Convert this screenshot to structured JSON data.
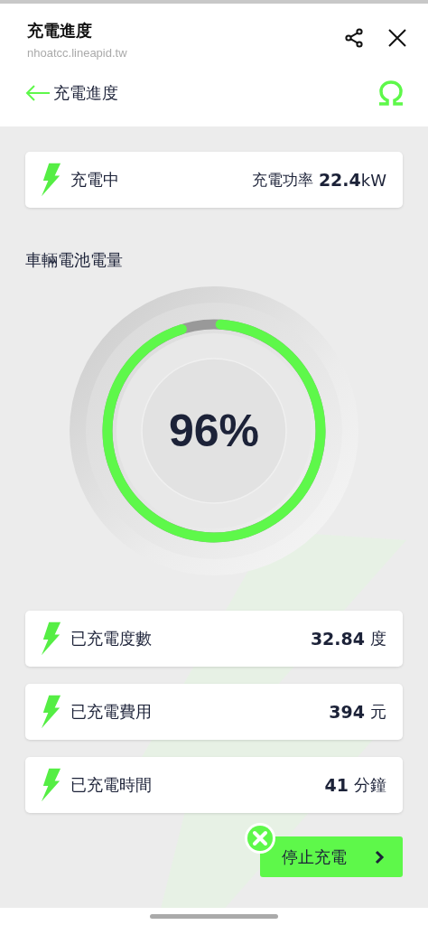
{
  "browser": {
    "title": "充電進度",
    "url": "nhoatcc.lineapid.tw"
  },
  "nav": {
    "title": "充電進度"
  },
  "status": {
    "label": "充電中",
    "power_label": "充電功率",
    "power_value": "22.4",
    "power_unit": "kW"
  },
  "battery": {
    "label": "車輛電池電量",
    "level": 0.96,
    "reading": "96%"
  },
  "stats": [
    {
      "label": "已充電度數",
      "value": "32.84",
      "unit": "度"
    },
    {
      "label": "已充電費用",
      "value": "394",
      "unit": "元"
    },
    {
      "label": "已充電時間",
      "value": "41",
      "unit": "分鐘"
    }
  ],
  "stop_button": {
    "label": "停止充電"
  }
}
